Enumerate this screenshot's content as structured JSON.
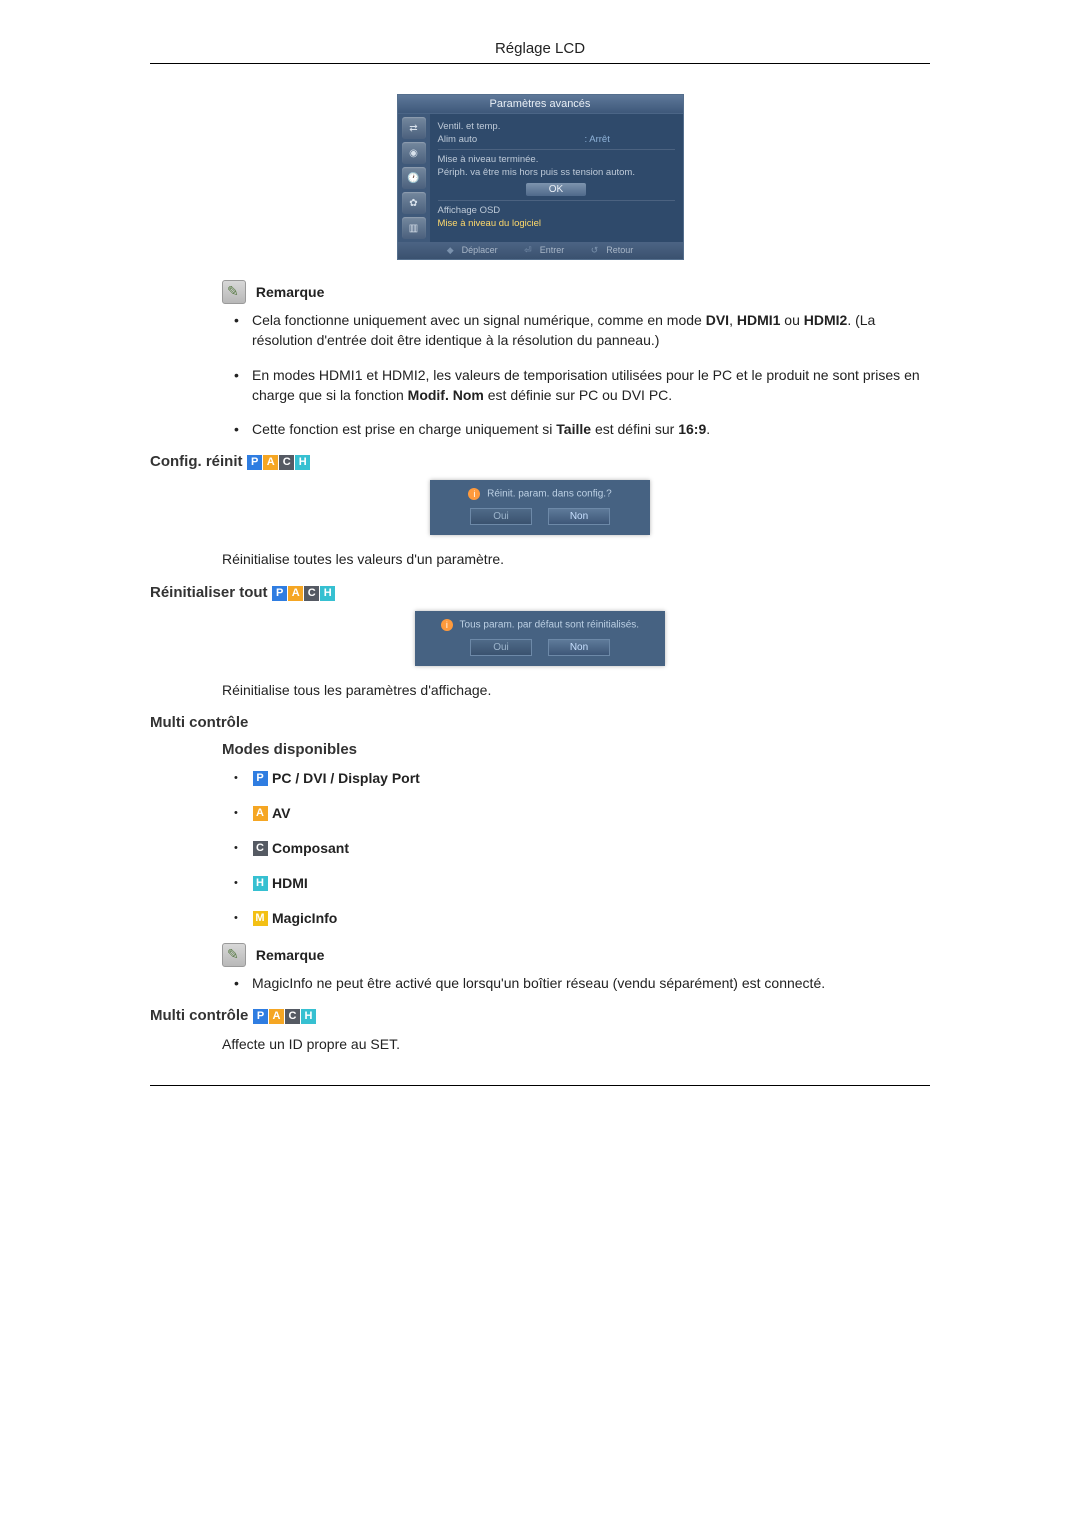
{
  "header": {
    "title": "Réglage LCD"
  },
  "osd": {
    "title": "Paramètres avancés",
    "rows": {
      "ventil": "Ventil. et temp.",
      "alimauto_label": "Alim auto",
      "alimauto_val": ": Arrêt",
      "leveling_done": "Mise à niveau terminée.",
      "periph_msg": "Périph. va être mis hors puis ss tension autom.",
      "ok": "OK",
      "affichage": "Affichage OSD",
      "mise_a_niveau": "Mise à niveau du logiciel"
    },
    "footer": {
      "deplacer": "Déplacer",
      "entrer": "Entrer",
      "retour": "Retour"
    }
  },
  "note_label": "Remarque",
  "remarks1": [
    {
      "pre": "Cela fonctionne uniquement avec un signal numérique, comme en mode ",
      "b1": "DVI",
      "mid1": ", ",
      "b2": "HDMI1",
      "mid2": " ou ",
      "b3": "HDMI2",
      "post": ". (La résolution d'entrée doit être identique à la résolution du panneau.)"
    },
    {
      "pre": "En modes HDMI1 et HDMI2, les valeurs de temporisation utilisées pour le PC et le produit ne sont prises en charge que si la fonction ",
      "b1": "Modif. Nom",
      "post": " est définie sur PC ou DVI PC."
    },
    {
      "pre": "Cette fonction est prise en charge uniquement si ",
      "b1": "Taille",
      "mid1": " est défini sur ",
      "b2": "16:9",
      "post": "."
    }
  ],
  "section_config_reinit": {
    "title": "Config. réinit",
    "dialog_msg": "Réinit. param. dans config.?",
    "yes": "Oui",
    "no": "Non",
    "body": "Réinitialise toutes les valeurs d'un paramètre."
  },
  "section_reinit_tout": {
    "title": "Réinitialiser tout",
    "dialog_msg": "Tous param. par défaut sont réinitialisés.",
    "yes": "Oui",
    "no": "Non",
    "body": "Réinitialise tous les paramètres d'affichage."
  },
  "section_multi": {
    "title": "Multi contrôle",
    "modes_title": "Modes disponibles",
    "modes": {
      "P": "PC / DVI / Display Port",
      "A": "AV",
      "C": "Composant",
      "H": "HDMI",
      "M": "MagicInfo"
    },
    "note_label": "Remarque",
    "note_text": "MagicInfo ne peut être activé que lorsqu'un boîtier réseau (vendu séparément) est connecté."
  },
  "section_multi_2": {
    "title": "Multi contrôle",
    "body": "Affecte un ID propre au SET."
  }
}
